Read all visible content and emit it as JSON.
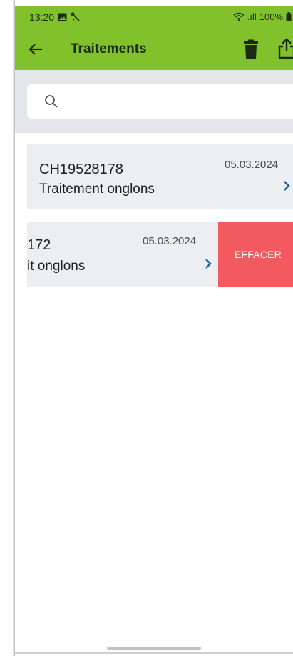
{
  "status_bar": {
    "time": "13:20",
    "battery": "100%",
    "signal_text": ".ıll"
  },
  "app_bar": {
    "title": "Traitements",
    "color": "#81c12c"
  },
  "search": {
    "placeholder": "",
    "value": ""
  },
  "items": [
    {
      "code": "CH19528178",
      "description": "Traitement onglons",
      "date": "05.03.2024"
    },
    {
      "code": "172",
      "description": "it onglons",
      "date": "05.03.2024",
      "swiped": true
    }
  ],
  "swipe_action": {
    "label": "EFFACER",
    "color": "#f25a60"
  },
  "icons": {
    "back": "arrow-left-icon",
    "trash": "trash-icon",
    "share": "share-icon",
    "search": "search-icon",
    "chevron": "chevron-right-icon"
  }
}
